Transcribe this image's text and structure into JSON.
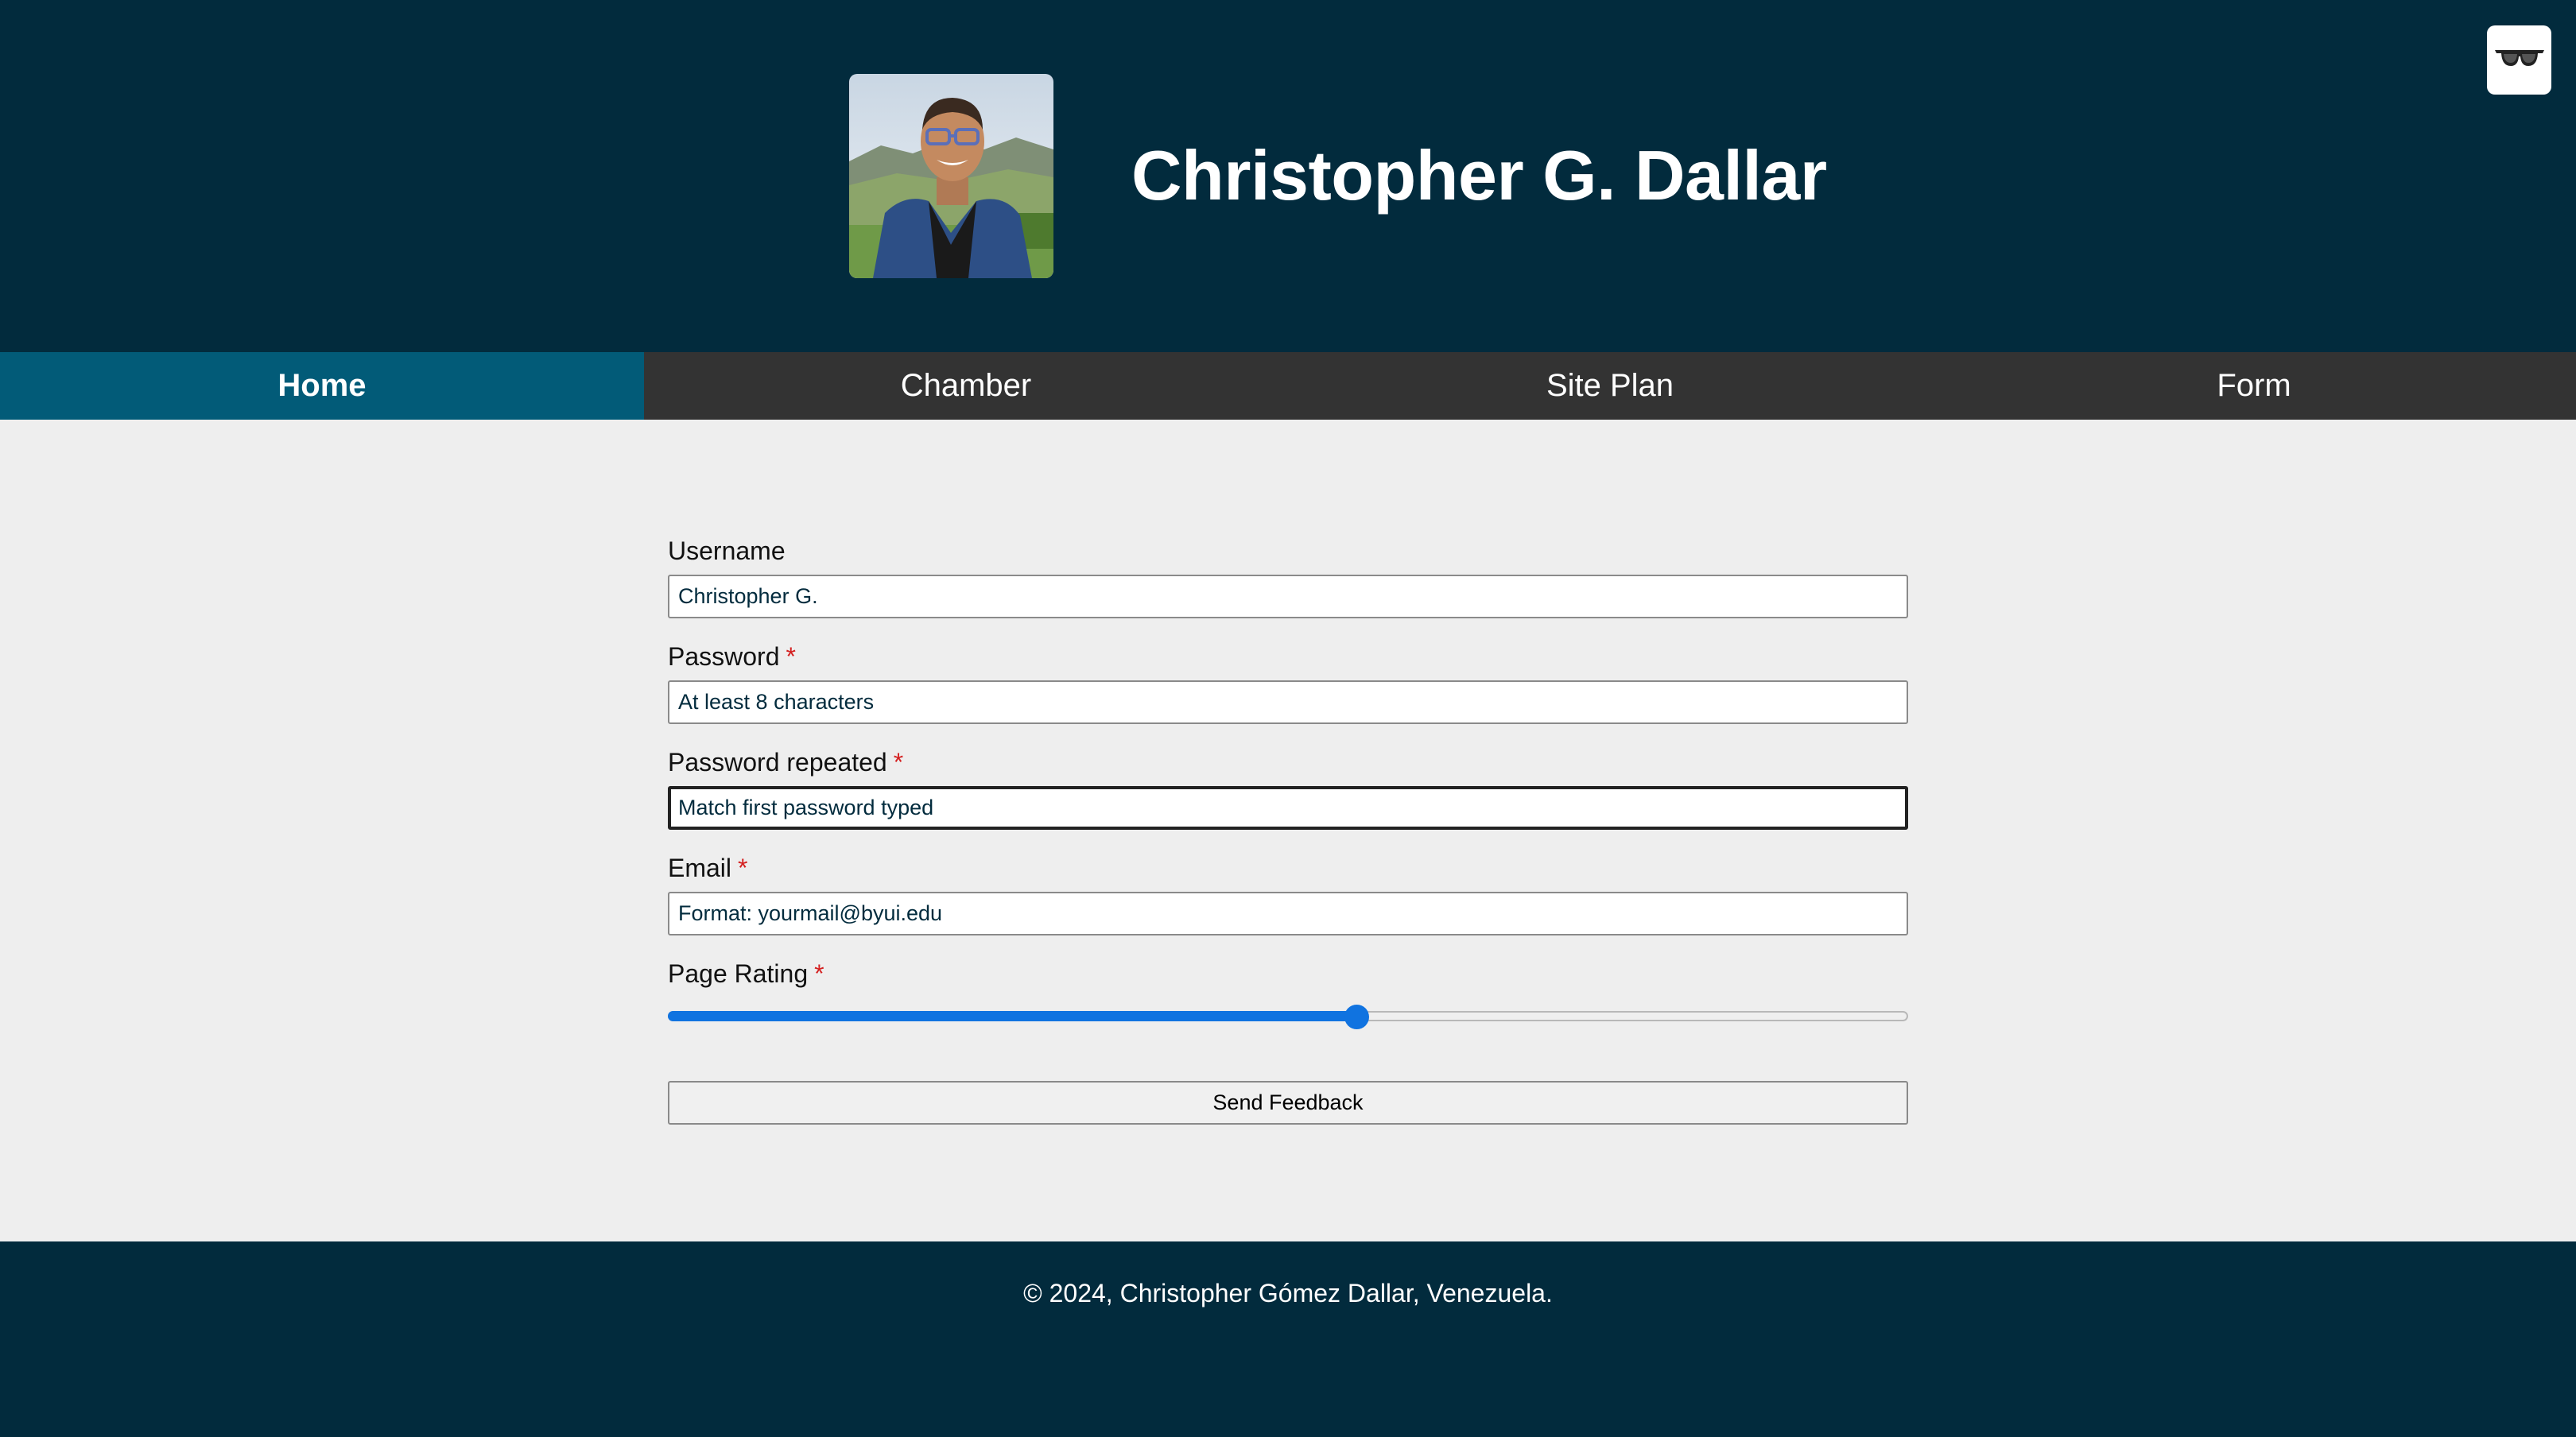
{
  "header": {
    "title": "Christopher G. Dallar",
    "avatar_icon": "profile-photo",
    "mode_toggle_icon": "sunglasses-icon"
  },
  "nav": {
    "items": [
      {
        "label": "Home",
        "active": true
      },
      {
        "label": "Chamber",
        "active": false
      },
      {
        "label": "Site Plan",
        "active": false
      },
      {
        "label": "Form",
        "active": false
      }
    ]
  },
  "form": {
    "username": {
      "label": "Username",
      "placeholder": "Christopher G.",
      "required": false
    },
    "password": {
      "label": "Password",
      "placeholder": "At least 8 characters",
      "required": true
    },
    "password_repeated": {
      "label": "Password repeated",
      "placeholder": "Match first password typed",
      "required": true
    },
    "email": {
      "label": "Email",
      "placeholder": "Format: yourmail@byui.edu",
      "required": true
    },
    "rating": {
      "label": "Page Rating",
      "required": true,
      "value_fraction": 0.555
    },
    "submit_label": "Send Feedback",
    "required_marker": "*"
  },
  "footer": {
    "text": "© 2024, Christopher Gómez Dallar, Venezuela."
  },
  "colors": {
    "header_bg": "#022b3d",
    "nav_bg": "#333333",
    "nav_active": "#025b78",
    "accent": "#1073e0",
    "required": "#d42020"
  }
}
